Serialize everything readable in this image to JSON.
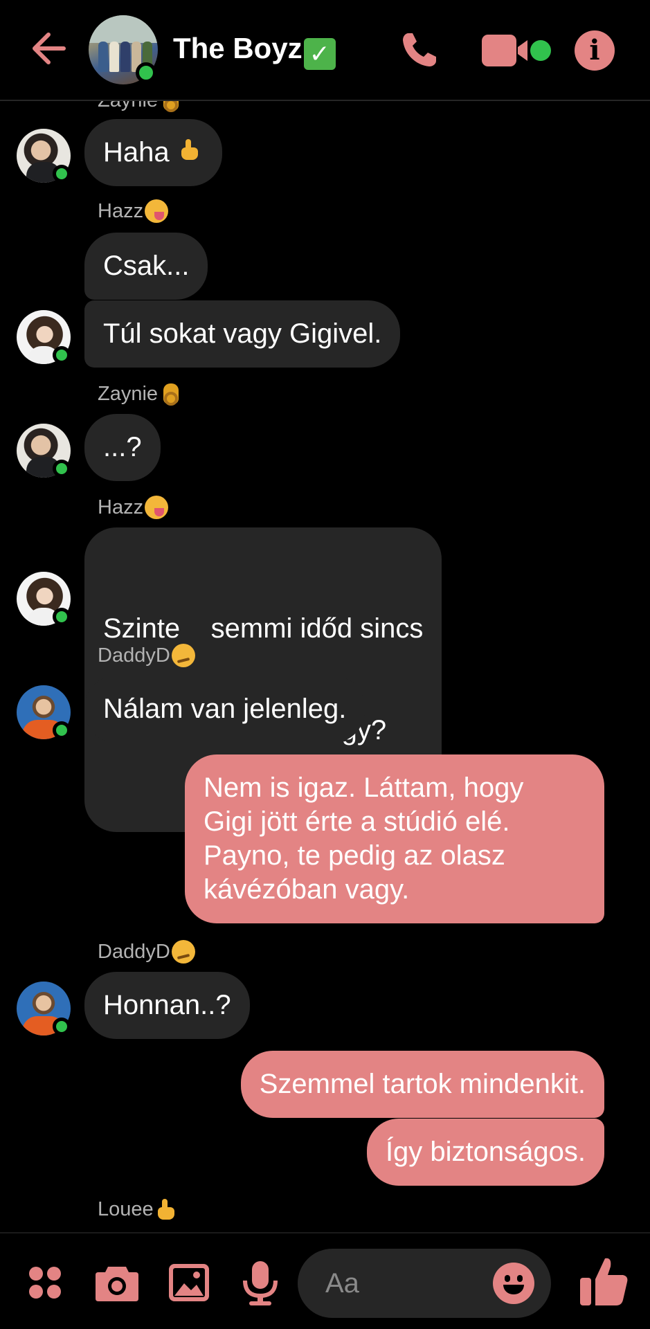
{
  "header": {
    "title": "The Boyz",
    "verified_emoji": "✅",
    "back_icon": "arrow-left-icon",
    "call_icon": "phone-icon",
    "video_icon": "video-camera-icon",
    "info_icon": "info-icon",
    "accent_color": "#e38484",
    "online_color": "#31c24d"
  },
  "messages": [
    {
      "type": "sender",
      "name": "Zaynie",
      "emoji": "ok-hand"
    },
    {
      "type": "incoming",
      "text": "Haha",
      "emoji": "middle-finger",
      "avatar": "zayn"
    },
    {
      "type": "sender",
      "name": "Hazz",
      "emoji": "yum-face"
    },
    {
      "type": "incoming",
      "text": "Csak..."
    },
    {
      "type": "incoming",
      "text": "Túl sokat vagy Gigivel.",
      "avatar": "harry"
    },
    {
      "type": "sender",
      "name": "Zaynie",
      "emoji": "ok-hand"
    },
    {
      "type": "incoming",
      "text": "...?",
      "avatar": "zayn"
    },
    {
      "type": "sender",
      "name": "Hazz",
      "emoji": "yum-face"
    },
    {
      "type": "incoming",
      "lines": [
        "Szinte    semmi időd sincs",
        "ránk. Most is hol vagy?"
      ],
      "avatar": "harry"
    },
    {
      "type": "sender",
      "name": "DaddyD",
      "emoji": "smirk-face"
    },
    {
      "type": "incoming",
      "text": "Nálam van jelenleg.",
      "avatar": "liam"
    },
    {
      "type": "outgoing",
      "lines": [
        "Nem is igaz. Láttam, hogy",
        "Gigi jött érte a stúdió elé.",
        "Payno, te pedig az olasz",
        "kávézóban vagy."
      ]
    },
    {
      "type": "sender",
      "name": "DaddyD",
      "emoji": "smirk-face"
    },
    {
      "type": "incoming",
      "text": "Honnan..?",
      "avatar": "liam"
    },
    {
      "type": "outgoing",
      "text": "Szemmel tartok mindenkit."
    },
    {
      "type": "outgoing",
      "text": "Így biztonságos."
    },
    {
      "type": "sender",
      "name": "Louee",
      "emoji": "middle-finger"
    }
  ],
  "composer": {
    "placeholder": "Aa",
    "icons": [
      "apps-icon",
      "camera-icon",
      "image-icon",
      "microphone-icon",
      "emoji-icon",
      "thumbs-up-icon"
    ]
  }
}
